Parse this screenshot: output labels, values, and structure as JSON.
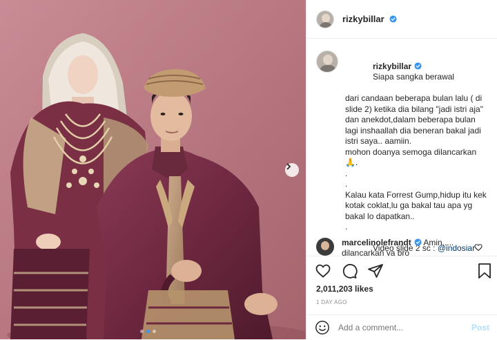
{
  "header": {
    "username": "rizkybillar",
    "verified_icon": "verified-badge-icon"
  },
  "caption": {
    "username": "rizkybillar",
    "lines": [
      "Siapa sangka berawal",
      "dari candaan beberapa bulan lalu ( di",
      "slide 2) ketika dia bilang \"jadi istri aja\"",
      "dan anekdot,dalam beberapa bulan",
      "lagi inshaallah dia beneran bakal jadi",
      "istri saya.. aamiin.",
      "mohon doanya semoga dilancarkan",
      "🙏.",
      ".",
      ".",
      "Kalau kata Forrest Gump,hidup itu kek",
      "kotak coklat,lu ga bakal tau apa yg",
      "bakal lo dapatkan..",
      ".",
      "Video slide 2 sc : "
    ],
    "mention": "@indosiar",
    "time": "1d"
  },
  "comment": {
    "username": "marcelinolefrandt",
    "text_line1": "Amin.....",
    "text_line2": "dilancarkan ya bro"
  },
  "actions": {
    "icons": [
      "heart-icon",
      "comment-icon",
      "share-icon",
      "bookmark-icon"
    ]
  },
  "likes": "2,011,203 likes",
  "posted_ago": "1 DAY AGO",
  "add_comment": {
    "placeholder": "Add a comment...",
    "post_label": "Post"
  },
  "colors": {
    "accent": "#3897f0",
    "post_disabled": "#b2dffc",
    "backdrop": "#b87681",
    "outfit": "#7a2f45"
  }
}
